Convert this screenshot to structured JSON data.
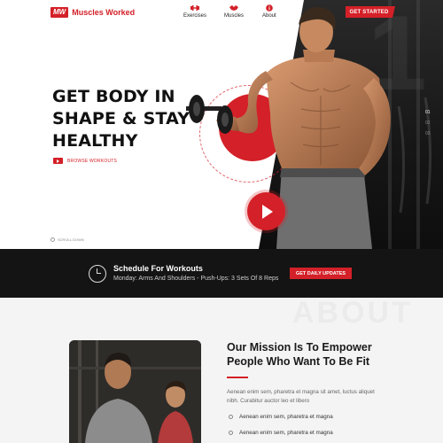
{
  "brand": {
    "badge": "MW",
    "name": "Muscles Worked",
    "accent": "#d42028"
  },
  "nav": {
    "items": [
      {
        "label": "Exercises",
        "icon": "dumbbell-icon"
      },
      {
        "label": "Muscles",
        "icon": "muscle-icon"
      },
      {
        "label": "About",
        "icon": "info-icon"
      }
    ],
    "cta": "GET STARTED"
  },
  "hero": {
    "headline_lines": [
      "GET BODY IN",
      "SHAPE & STAY",
      "HEALTHY"
    ],
    "browse_label": "BROWSE WORKOUTS",
    "scroll_label": "SCROLL DOWN",
    "pager": [
      "01",
      "02",
      "03"
    ]
  },
  "schedule": {
    "title": "Schedule For Workouts",
    "subtitle": "Monday: Arms And Shoulders - Push-Ups: 3 Sets Of 8 Reps",
    "button": "GET DAILY UPDATES"
  },
  "mission": {
    "ghost_word": "ABOUT",
    "title_lines": [
      "Our Mission Is To Empower",
      "People Who Want To Be Fit"
    ],
    "body": "Aenean enim sem, pharetra et magna sit amet, luctus aliquet nibh. Curabitur auctor leo et libero",
    "bullets": [
      "Aenean enim sem, pharetra et magna",
      "Aenean enim sem, pharetra et magna"
    ]
  }
}
